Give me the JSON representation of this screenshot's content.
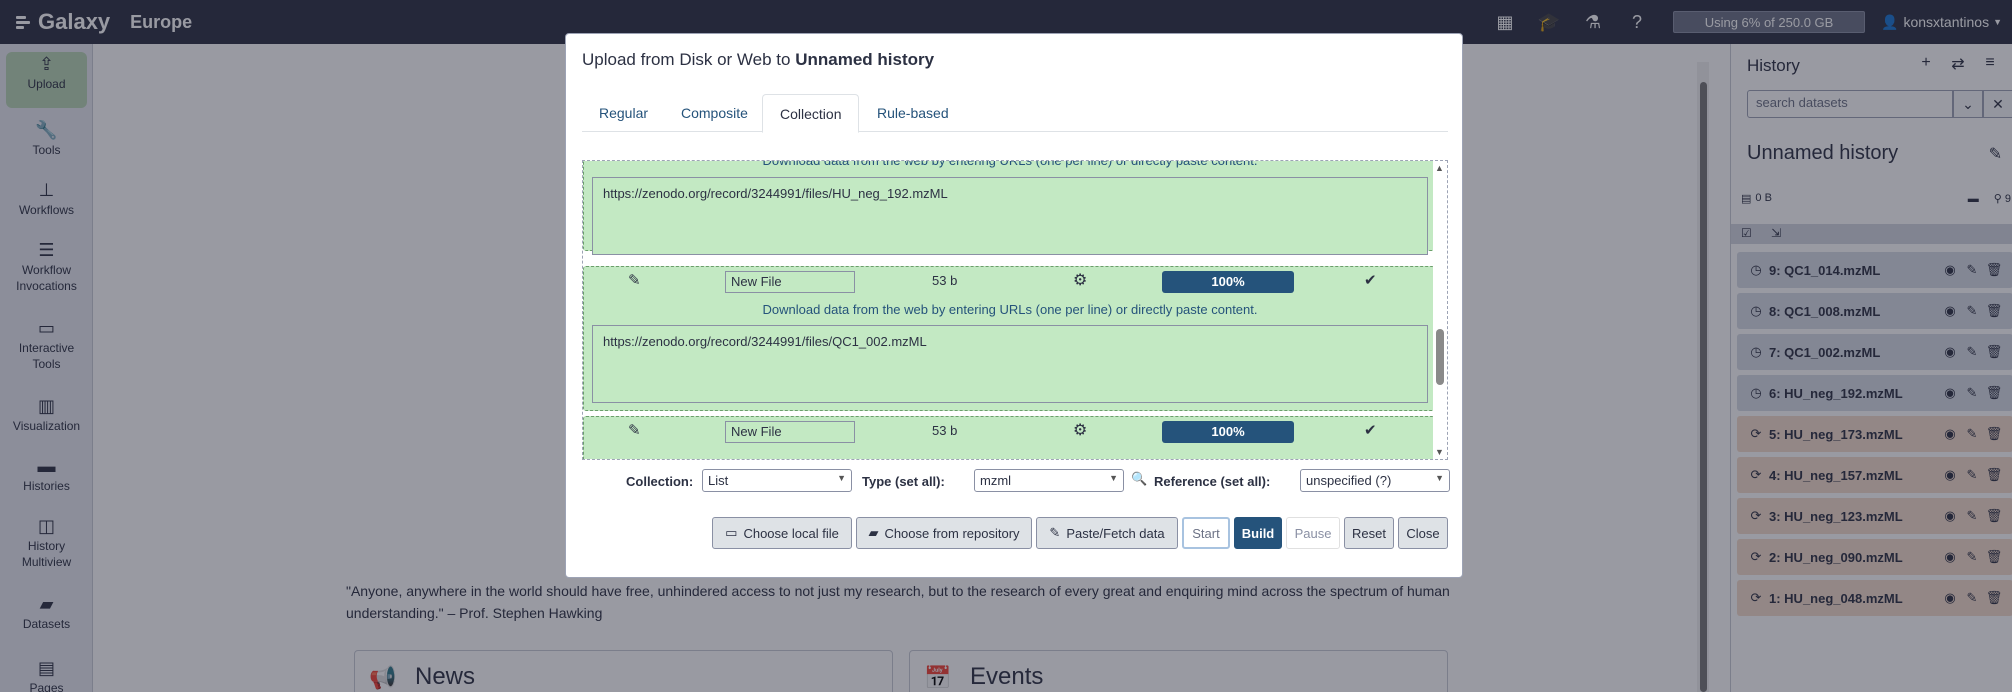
{
  "navbar": {
    "brand": "Galaxy",
    "sub": "Europe",
    "quota": "Using 6% of 250.0 GB",
    "user": "konsxtantinos"
  },
  "activity": [
    {
      "label": "Upload",
      "icon": "upload-icon"
    },
    {
      "label": "Tools",
      "icon": "wrench-icon"
    },
    {
      "label": "Workflows",
      "icon": "sitemap-icon"
    },
    {
      "label": "Workflow Invocations",
      "icon": "list-icon"
    },
    {
      "label": "Interactive Tools",
      "icon": "laptop-icon"
    },
    {
      "label": "Visualization",
      "icon": "chart-icon"
    },
    {
      "label": "Histories",
      "icon": "hdd-icon"
    },
    {
      "label": "History Multiview",
      "icon": "columns-icon"
    },
    {
      "label": "Datasets",
      "icon": "folder-icon"
    },
    {
      "label": "Pages",
      "icon": "file-icon"
    }
  ],
  "center": {
    "quote": "\"Anyone, anywhere in the world should have free, unhindered access to not just my research, but to the research of every great and enquiring mind across the spectrum of human understanding.\" – Prof. Stephen Hawking",
    "news": "News",
    "events": "Events"
  },
  "history": {
    "title": "History",
    "search_placeholder": "search datasets",
    "name": "Unnamed history",
    "size": "0 B",
    "count": "9",
    "datasets": [
      {
        "label": "9: QC1_014.mzML",
        "state": "queued"
      },
      {
        "label": "8: QC1_008.mzML",
        "state": "queued"
      },
      {
        "label": "7: QC1_002.mzML",
        "state": "queued"
      },
      {
        "label": "6: HU_neg_192.mzML",
        "state": "queued"
      },
      {
        "label": "5: HU_neg_173.mzML",
        "state": "new"
      },
      {
        "label": "4: HU_neg_157.mzML",
        "state": "new"
      },
      {
        "label": "3: HU_neg_123.mzML",
        "state": "new"
      },
      {
        "label": "2: HU_neg_090.mzML",
        "state": "new"
      },
      {
        "label": "1: HU_neg_048.mzML",
        "state": "new"
      }
    ]
  },
  "modal": {
    "title_prefix": "Upload from Disk or Web to ",
    "title_history": "Unnamed history",
    "tabs": [
      "Regular",
      "Composite",
      "Collection",
      "Rule-based"
    ],
    "active_tab": "Collection",
    "hint": "Download data from the web by entering URLs (one per line) or directly paste content.",
    "rows": [
      {
        "url": "https://zenodo.org/record/3244991/files/HU_neg_192.mzML"
      },
      {
        "name": "New File",
        "size": "53 b",
        "progress": "100%",
        "url": "https://zenodo.org/record/3244991/files/QC1_002.mzML"
      },
      {
        "name": "New File",
        "size": "53 b",
        "progress": "100%"
      }
    ],
    "settings": {
      "collection_label": "Collection:",
      "collection_value": "List",
      "type_label": "Type (set all):",
      "type_value": "mzml",
      "reference_label": "Reference (set all):",
      "reference_value": "unspecified (?)"
    },
    "buttons": {
      "local": "Choose local file",
      "repo": "Choose from repository",
      "paste": "Paste/Fetch data",
      "start": "Start",
      "build": "Build",
      "pause": "Pause",
      "reset": "Reset",
      "close": "Close"
    }
  }
}
